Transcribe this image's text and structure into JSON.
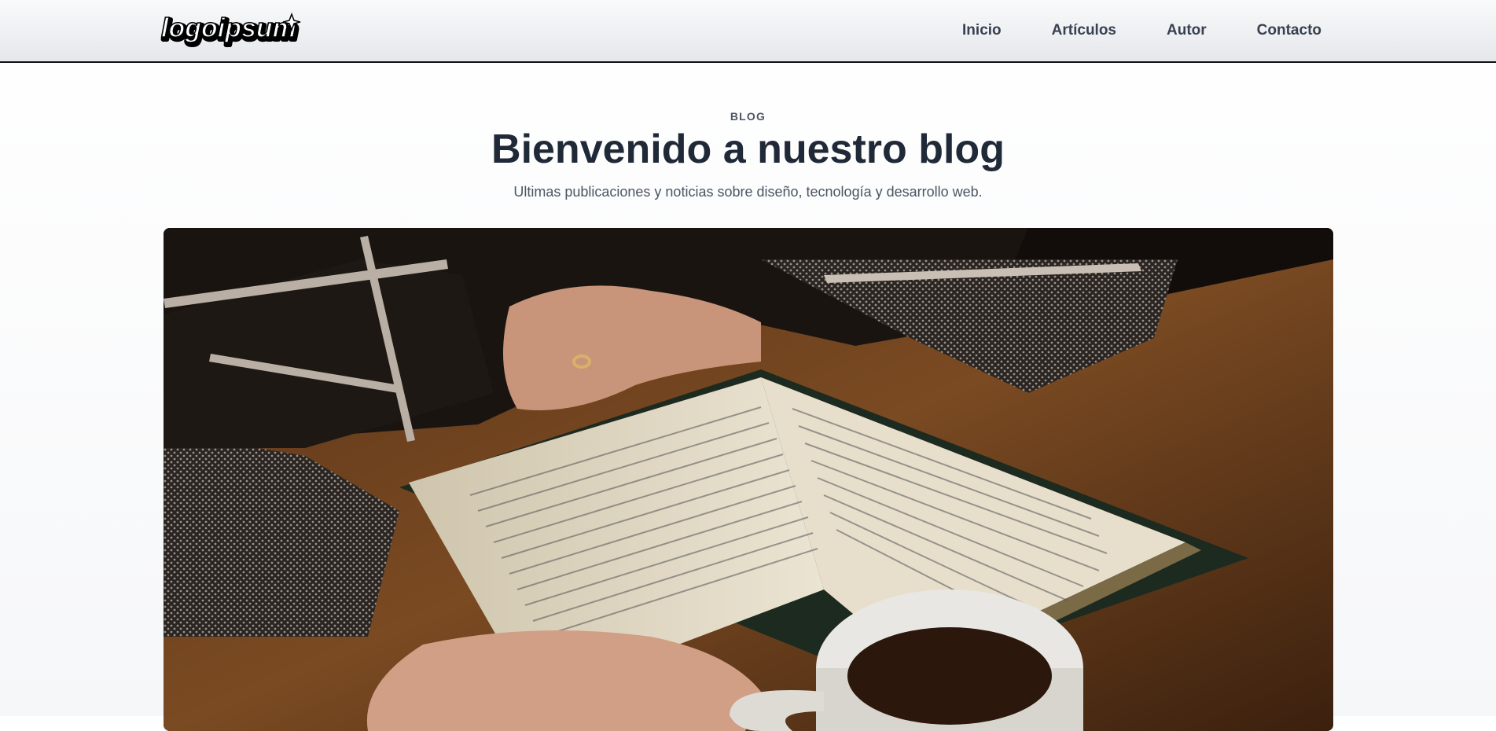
{
  "header": {
    "logo_text": "logoipsum",
    "nav": [
      {
        "label": "Inicio"
      },
      {
        "label": "Artículos"
      },
      {
        "label": "Autor"
      },
      {
        "label": "Contacto"
      }
    ]
  },
  "hero_section": {
    "eyebrow": "BLOG",
    "title": "Bienvenido a nuestro blog",
    "subtitle": "Ultimas publicaciones y noticias sobre diseño, tecnología y desarrollo web."
  },
  "colors": {
    "heading": "#1f2937",
    "nav_text": "#374151",
    "header_border": "#111111"
  }
}
